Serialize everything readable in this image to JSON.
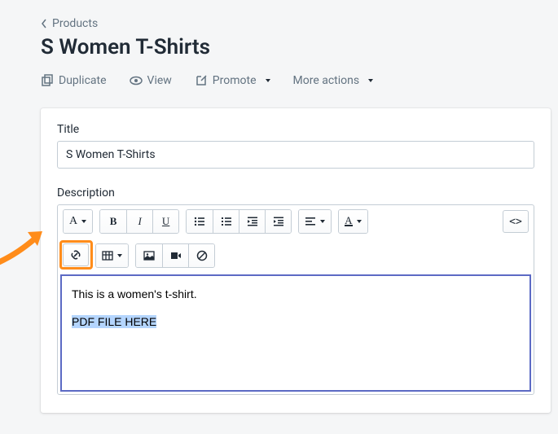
{
  "breadcrumb": {
    "label": "Products"
  },
  "page": {
    "title": "S Women T-Shirts"
  },
  "actions": {
    "duplicate": "Duplicate",
    "view": "View",
    "promote": "Promote",
    "more": "More actions"
  },
  "form": {
    "title_label": "Title",
    "title_value": "S Women T-Shirts",
    "description_label": "Description"
  },
  "toolbar": {
    "format": "A",
    "bold": "B",
    "italic": "I",
    "underline": "U",
    "color": "A",
    "code": "<>"
  },
  "editor": {
    "line1": "This is a women's t-shirt.",
    "highlighted": "PDF FILE HERE"
  }
}
